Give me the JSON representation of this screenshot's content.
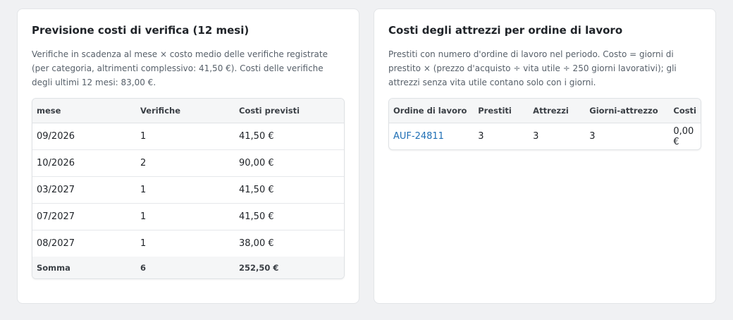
{
  "forecast": {
    "title": "Previsione costi di verifica (12 mesi)",
    "description": "Verifiche in scadenza al mese × costo medio delle verifiche registrate (per categoria, altrimenti complessivo: 41,50 €). Costi delle verifiche degli ultimi 12 mesi: 83,00 €.",
    "columns": [
      "mese",
      "Verifiche",
      "Costi previsti"
    ],
    "rows": [
      {
        "month": "09/2026",
        "count": "1",
        "cost": "41,50 €"
      },
      {
        "month": "10/2026",
        "count": "2",
        "cost": "90,00 €"
      },
      {
        "month": "03/2027",
        "count": "1",
        "cost": "41,50 €"
      },
      {
        "month": "07/2027",
        "count": "1",
        "cost": "41,50 €"
      },
      {
        "month": "08/2027",
        "count": "1",
        "cost": "38,00 €"
      }
    ],
    "total": {
      "label": "Somma",
      "count": "6",
      "cost": "252,50 €"
    }
  },
  "tools": {
    "title": "Costi degli attrezzi per ordine di lavoro",
    "description": "Prestiti con numero d'ordine di lavoro nel periodo. Costo = giorni di prestito × (prezzo d'acquisto ÷ vita utile ÷ 250 giorni lavorativi); gli attrezzi senza vita utile contano solo con i giorni.",
    "columns": [
      "Ordine di lavoro",
      "Prestiti",
      "Attrezzi",
      "Giorni-attrezzo",
      "Costi"
    ],
    "rows": [
      {
        "order": "AUF-24811",
        "loans": "3",
        "tools": "3",
        "tool_days": "3",
        "cost": "0,00 €"
      }
    ]
  },
  "colors": {
    "link": "#1f6fb5",
    "background": "#f0f1f3"
  }
}
